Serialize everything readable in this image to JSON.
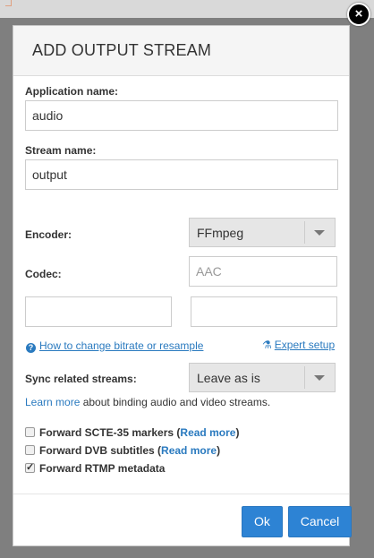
{
  "dialog": {
    "title": "ADD OUTPUT STREAM",
    "close_glyph": "×"
  },
  "form": {
    "application_name_label": "Application name:",
    "application_name_value": "audio",
    "stream_name_label": "Stream name:",
    "stream_name_value": "output",
    "encoder_label": "Encoder:",
    "encoder_value": "FFmpeg",
    "codec_label": "Codec:",
    "codec_placeholder": "AAC",
    "extra_field_1_value": "",
    "extra_field_2_value": "",
    "bitrate_link": "How to change bitrate or resample",
    "expert_link": "Expert setup",
    "sync_label": "Sync related streams:",
    "sync_value": "Leave as is",
    "learn_more_link": "Learn more",
    "learn_more_text": " about binding audio and video streams."
  },
  "options": [
    {
      "label": "Forward SCTE-35 markers",
      "read_more": "Read more",
      "checked": false
    },
    {
      "label": "Forward DVB subtitles",
      "read_more": "Read more",
      "checked": false
    },
    {
      "label": "Forward RTMP metadata",
      "read_more": "",
      "checked": true
    }
  ],
  "buttons": {
    "ok": "Ok",
    "cancel": "Cancel"
  },
  "icons": {
    "help": "question-circle-icon",
    "expert": "flask-icon",
    "close": "close-icon"
  },
  "colors": {
    "accent": "#2d83d4",
    "link": "#2a7abf"
  }
}
